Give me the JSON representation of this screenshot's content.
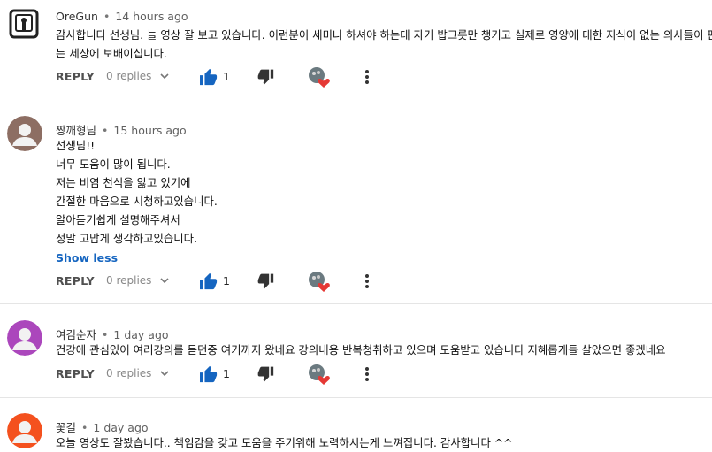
{
  "common": {
    "reply_label": "REPLY",
    "replies_label": "0 replies",
    "separator": "•"
  },
  "comments": [
    {
      "author": "OreGun",
      "time": "14 hours ago",
      "avatar_color": "#ffffff",
      "lines": [
        "감사합니다 선생님. 늘 영상 잘 보고 있습니다. 이런분이 세미나 하셔야 하는데 자기 밥그릇만 챙기고 실제로 영양에 대한 지식이 없는 의사들이 판치",
        "는 세상에 보배이십니다."
      ],
      "likes": "1"
    },
    {
      "author": "짱깨형님",
      "time": "15 hours ago",
      "avatar_color": "#8d6e63",
      "lines": [
        "선생님!!",
        "너무 도움이 많이 됩니다.",
        "저는 비염 천식을 앓고 있기에",
        "간절한 마음으로 시청하고있습니다.",
        "알아듣기쉽게 설명해주셔서",
        "정말 고맙게 생각하고있습니다."
      ],
      "show_less": "Show less",
      "likes": "1"
    },
    {
      "author": "여김순자",
      "time": "1 day ago",
      "avatar_color": "#ab47bc",
      "lines": [
        "건강에 관심있어 여러강의를 듣던중 여기까지 왔네요 강의내용 반복청취하고 있으며 도움받고 있습니다 지혜롭게들 살았으면 좋겠네요"
      ],
      "likes": "1"
    },
    {
      "author": "꽃길",
      "time": "1 day ago",
      "avatar_color": "#f4511e",
      "lines": [
        "오늘 영상도 잘봤습니다.. 책임감을 갖고 도움을 주기위해 노력하시는게 느껴집니다. 감사합니다 ^^"
      ]
    }
  ],
  "colors": {
    "like_blue": "#1565c0",
    "heart_red": "#e53935",
    "link_blue": "#1565c0"
  }
}
